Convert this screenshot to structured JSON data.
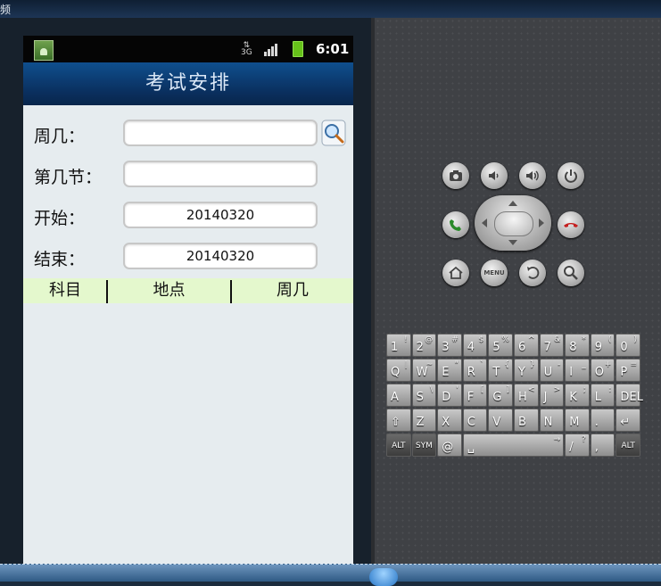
{
  "window": {
    "title": "频"
  },
  "status_bar": {
    "network": "3G",
    "time": "6:01"
  },
  "app": {
    "title": "考试安排",
    "form": {
      "weekday": {
        "label": "周几：",
        "value": ""
      },
      "period": {
        "label": "第几节：",
        "value": ""
      },
      "start": {
        "label": "开始：",
        "value": "20140320"
      },
      "end": {
        "label": "结束：",
        "value": "20140320"
      }
    },
    "table": {
      "columns": [
        "科目",
        "地点",
        "周几"
      ]
    }
  },
  "hardware_buttons": [
    "camera-icon",
    "volume-down-icon",
    "volume-up-icon",
    "power-icon",
    "call-icon",
    "end-call-icon",
    "home-icon",
    "menu-button",
    "back-icon",
    "search-icon"
  ],
  "menu_label": "MENU",
  "keyboard": {
    "row1": [
      [
        "1",
        "!"
      ],
      [
        "2",
        "@"
      ],
      [
        "3",
        "#"
      ],
      [
        "4",
        "$"
      ],
      [
        "5",
        "%"
      ],
      [
        "6",
        "^"
      ],
      [
        "7",
        "&"
      ],
      [
        "8",
        "*"
      ],
      [
        "9",
        "("
      ],
      [
        "0",
        ")"
      ]
    ],
    "row2": [
      [
        "Q",
        "|"
      ],
      [
        "W",
        "~"
      ],
      [
        "E",
        "\""
      ],
      [
        "R",
        "`"
      ],
      [
        "T",
        "{"
      ],
      [
        "Y",
        "}"
      ],
      [
        "U",
        "-"
      ],
      [
        "I",
        "_"
      ],
      [
        "O",
        "+"
      ],
      [
        "P",
        "="
      ]
    ],
    "row3": [
      [
        "A",
        ""
      ],
      [
        "S",
        "\\"
      ],
      [
        "D",
        "'"
      ],
      [
        "F",
        "["
      ],
      [
        "G",
        "]"
      ],
      [
        "H",
        "<"
      ],
      [
        "J",
        ">"
      ],
      [
        "K",
        ";"
      ],
      [
        "L",
        ":"
      ],
      [
        "DEL",
        ""
      ]
    ],
    "row4": [
      [
        "⇧",
        ""
      ],
      [
        "Z",
        ""
      ],
      [
        "X",
        ""
      ],
      [
        "C",
        ""
      ],
      [
        "V",
        ""
      ],
      [
        "B",
        ""
      ],
      [
        "N",
        ""
      ],
      [
        "M",
        ""
      ],
      [
        ".",
        ""
      ],
      [
        "↵",
        ""
      ]
    ],
    "row5": [
      [
        "ALT",
        ""
      ],
      [
        "SYM",
        ""
      ],
      [
        "@",
        ""
      ],
      [
        "␣",
        "→"
      ],
      [
        "/",
        "?"
      ],
      [
        ",",
        ""
      ],
      [
        "ALT",
        ""
      ]
    ]
  }
}
